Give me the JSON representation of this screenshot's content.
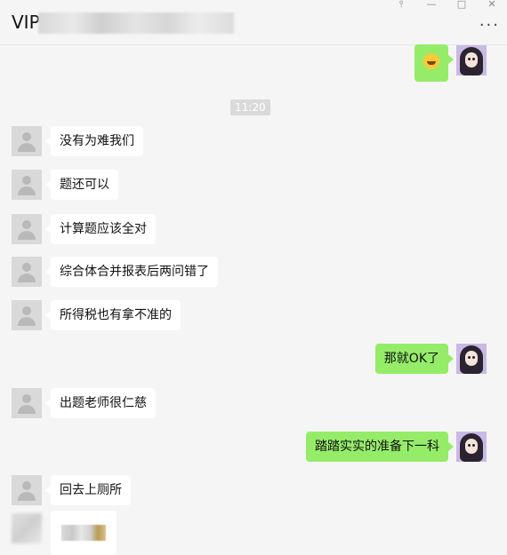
{
  "header": {
    "title": "VIP",
    "more_label": "···",
    "window_buttons": [
      "pin-icon",
      "minimize-icon",
      "maximize-icon",
      "close-icon"
    ]
  },
  "time_divider": "11:20",
  "messages": [
    {
      "side": "right",
      "type": "emoji",
      "icon": "laughing-emoji-icon"
    },
    {
      "side": "left",
      "text": "没有为难我们"
    },
    {
      "side": "left",
      "text": "题还可以"
    },
    {
      "side": "left",
      "text": "计算题应该全对"
    },
    {
      "side": "left",
      "text": "综合体合并报表后两问错了"
    },
    {
      "side": "left",
      "text": "所得税也有拿不准的"
    },
    {
      "side": "right",
      "text": "那就OK了"
    },
    {
      "side": "left",
      "text": "出题老师很仁慈"
    },
    {
      "side": "right",
      "text": "踏踏实实的准备下一科"
    },
    {
      "side": "left",
      "text": "回去上厕所"
    },
    {
      "side": "left",
      "type": "redacted"
    }
  ],
  "colors": {
    "background": "#f5f5f5",
    "bubble_self": "#95ec69",
    "bubble_other": "#ffffff"
  }
}
